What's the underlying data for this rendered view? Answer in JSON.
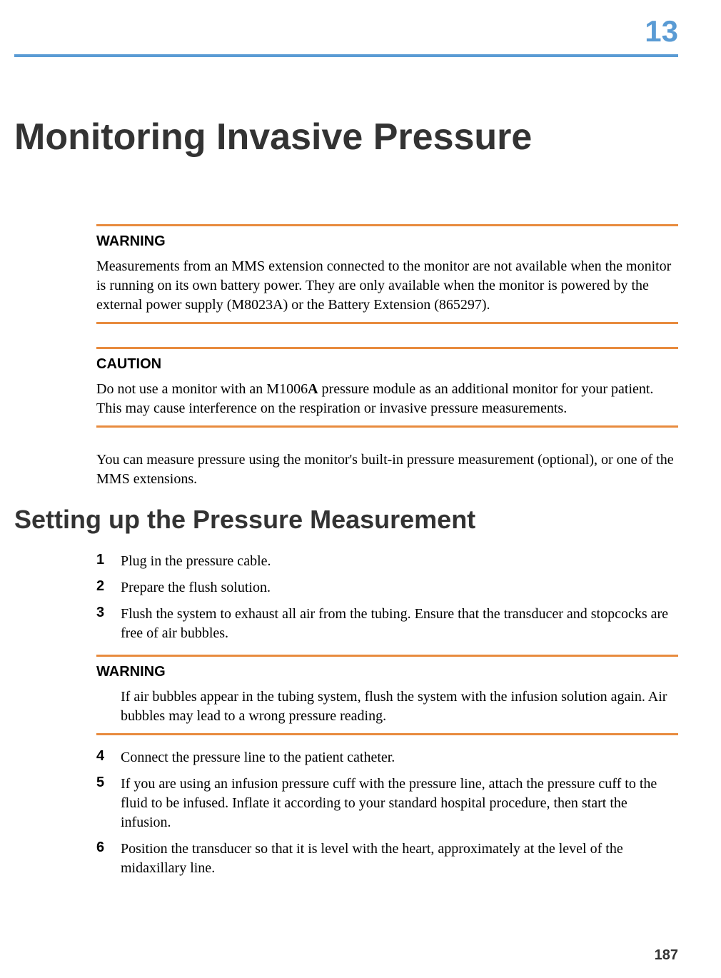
{
  "header": {
    "chapter_number": "13",
    "chapter_title": "Monitoring Invasive Pressure"
  },
  "warning1": {
    "label": "WARNING",
    "text": "Measurements from an MMS extension connected to the monitor are not available when the monitor is running on its own battery power. They are only available when the monitor is powered by the external power supply (M8023A) or the Battery Extension (865297)."
  },
  "caution1": {
    "label": "CAUTION",
    "prefix": "Do not use a monitor with an M1006",
    "bold": "A",
    "suffix": " pressure module as an additional monitor for your patient. This may cause interference on the respiration or invasive pressure measurements."
  },
  "intro_para": "You can measure pressure using the monitor's built-in pressure measurement (optional), or one of the MMS extensions.",
  "section_heading": "Setting up the Pressure Measurement",
  "steps": {
    "n1": "1",
    "t1": "Plug in the pressure cable.",
    "n2": "2",
    "t2": "Prepare the flush solution.",
    "n3": "3",
    "t3": "Flush the system to exhaust all air from the tubing. Ensure that the transducer and stopcocks are free of air bubbles.",
    "n4": "4",
    "t4": "Connect the pressure line to the patient catheter.",
    "n5": "5",
    "t5": "If you are using an infusion pressure cuff with the pressure line, attach the pressure cuff to the fluid to be infused. Inflate it according to your standard hospital procedure, then start the infusion.",
    "n6": "6",
    "t6": "Position the transducer so that it is level with the heart, approximately at the level of the midaxillary line."
  },
  "warning2": {
    "label": "WARNING",
    "text": "If air bubbles appear in the tubing system, flush the system with the infusion solution again. Air bubbles may lead to a wrong pressure reading."
  },
  "page_number": "187"
}
